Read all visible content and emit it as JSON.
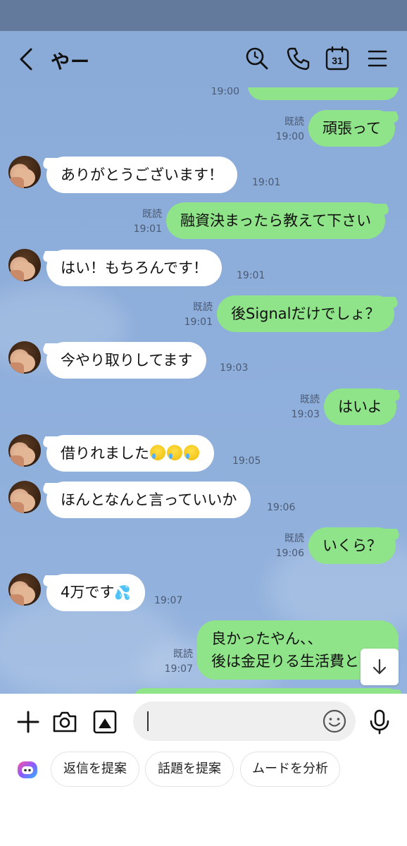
{
  "header": {
    "title": "やー",
    "icons": [
      "back-chevron-icon",
      "search-history-icon",
      "phone-icon",
      "calendar-icon",
      "menu-icon"
    ],
    "calendar_day": "31"
  },
  "messages": [
    {
      "side": "right",
      "text": "頑張って",
      "read": "既読",
      "time": "19:00"
    },
    {
      "side": "left",
      "text": "ありがとうございます！",
      "time": "19:01"
    },
    {
      "side": "right",
      "text": "融資決まったら教えて下さい",
      "read": "既読",
      "time": "19:01"
    },
    {
      "side": "left",
      "text": "はい！もちろんです！",
      "time": "19:01"
    },
    {
      "side": "right",
      "text": "後Signalだけでしょ？",
      "read": "既読",
      "time": "19:01"
    },
    {
      "side": "left",
      "text": "今やり取りしてます",
      "time": "19:03"
    },
    {
      "side": "right",
      "text": "はいよ",
      "read": "既読",
      "time": "19:03"
    },
    {
      "side": "left",
      "text": "借りれました",
      "emoji": "crying-face-emoji x3",
      "time": "19:05"
    },
    {
      "side": "left",
      "text": "ほんとなんと言っていいか",
      "time": "19:06"
    },
    {
      "side": "right",
      "text": "いくら？",
      "read": "既読",
      "time": "19:06"
    },
    {
      "side": "left",
      "text": "4万です",
      "emoji": "sweat-emoji",
      "time": "19:07"
    },
    {
      "side": "right",
      "text_line1": "良かったやん、、",
      "text_line2": "後は金足りる生活費と",
      "read": "既読",
      "time": "19:07"
    }
  ],
  "partial_top_time": "19:00",
  "input": {
    "placeholder": "",
    "icons": [
      "plus-icon",
      "camera-icon",
      "image-icon",
      "emoji-icon",
      "microphone-icon"
    ]
  },
  "suggestions": [
    "返信を提案",
    "話題を提案",
    "ムードを分析"
  ],
  "colors": {
    "chat_bg": "#8aaad8",
    "status_bar": "#647a9c",
    "my_bubble": "#8fe388",
    "their_bubble": "#ffffff"
  }
}
